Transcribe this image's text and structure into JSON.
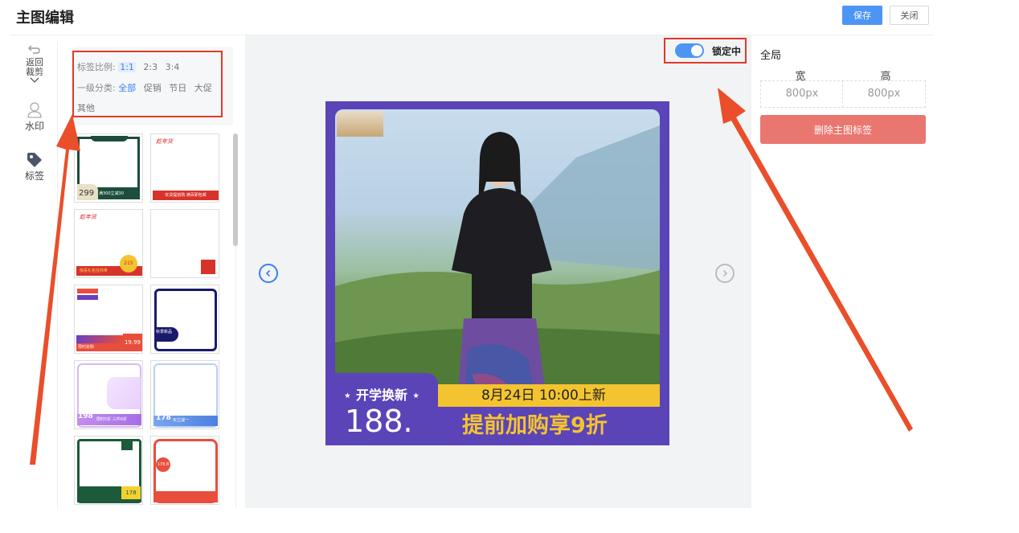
{
  "header": {
    "title": "主图编辑",
    "save_label": "保存",
    "close_label": "关闭"
  },
  "tools": {
    "back_crop": "返回裁剪",
    "back_crop_line1": "返回",
    "back_crop_line2": "裁剪",
    "watermark": "水印",
    "tag": "标签"
  },
  "filter": {
    "ratio_label": "标签比例:",
    "ratios": [
      "1:1",
      "2:3",
      "3:4"
    ],
    "active_ratio": "1:1",
    "category_label": "一级分类:",
    "categories": [
      "全部",
      "促销",
      "节日",
      "大促",
      "其他"
    ],
    "active_category": "全部"
  },
  "template_cards": [
    {
      "text_main": "满300立减30",
      "price": "299"
    },
    {
      "text_main": "年货提前购 满百即包邮",
      "logo": "趁年货"
    },
    {
      "text_main": "惊喜礼包任你拿",
      "logo": "趁年货",
      "badge": "215"
    },
    {
      "text_main": ""
    },
    {
      "text_main": "限时抢购",
      "price": "19.99"
    },
    {
      "text_main": "秋季新品"
    },
    {
      "text_main": "限时5折 三件6折",
      "price": "198"
    },
    {
      "text_main": "买立减一",
      "price": "178"
    },
    {
      "text_main": "",
      "price": "178"
    },
    {
      "text_main": "",
      "price": "178.8"
    }
  ],
  "canvas": {
    "lock_label": "锁定中",
    "lock_on": true,
    "image": {
      "banner_left": "开学换新",
      "price": "188.",
      "date_text": "8月24日 10:00上新",
      "promo": "提前加购享9折",
      "frame_color": "#5a44b8",
      "banner_yellow": "#f4c430"
    }
  },
  "right_panel": {
    "section": "全局",
    "width_label": "宽",
    "height_label": "高",
    "width_value": "800px",
    "height_value": "800px",
    "delete_label": "删除主图标签"
  },
  "colors": {
    "accent": "#4d95f5",
    "highlight": "#e0392b",
    "delete": "#ea7670"
  }
}
